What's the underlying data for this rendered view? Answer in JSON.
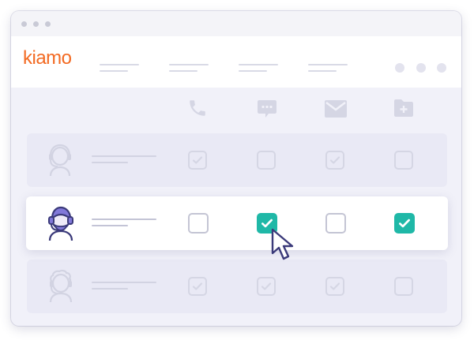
{
  "app": {
    "logo_text": "kiamo",
    "logo_color": "#f36a22"
  },
  "colors": {
    "accent": "#1fb8a7",
    "muted": "#d5d6e4",
    "background": "#f1f1f9"
  },
  "channels": [
    {
      "name": "phone",
      "icon": "phone-icon"
    },
    {
      "name": "chat",
      "icon": "chat-bubble-icon"
    },
    {
      "name": "email",
      "icon": "envelope-icon"
    },
    {
      "name": "folder-add",
      "icon": "folder-add-icon"
    }
  ],
  "agents": [
    {
      "avatar": "agent-headset-icon",
      "state": "dimmed",
      "checked": [
        true,
        false,
        true,
        false
      ]
    },
    {
      "avatar": "agent-headset-icon",
      "state": "active",
      "checked": [
        false,
        true,
        false,
        true
      ]
    },
    {
      "avatar": "agent-curly-headset-icon",
      "state": "dimmed",
      "checked": [
        true,
        true,
        true,
        false
      ]
    }
  ]
}
